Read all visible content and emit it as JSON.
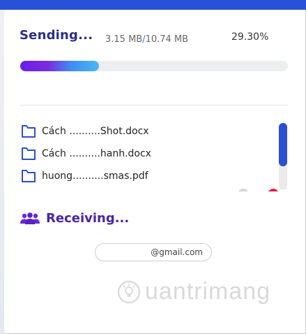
{
  "sending": {
    "title": "Sending...",
    "transferred": "3.15 MB",
    "separator": "/",
    "total": "10.74 MB",
    "percent_text": "29.30%",
    "progress_fraction": 0.293
  },
  "files": [
    {
      "name": "Cách ..........Shot.docx",
      "icon": "folder-icon"
    },
    {
      "name": "Cách ..........hanh.docx",
      "icon": "folder-icon"
    },
    {
      "name": "huong..........smas.pdf",
      "icon": "folder-icon"
    }
  ],
  "receiving": {
    "title": "Receiving...",
    "icon": "users-icon"
  },
  "email": {
    "text": "@gmail.com"
  },
  "watermark": {
    "text": "uantrimang"
  },
  "colors": {
    "topbar": "#2852d6",
    "title": "#2b2f86",
    "receiving": "#4a22a8",
    "scroll_thumb": "#2a4fd0",
    "folder": "#2d4fc9"
  }
}
